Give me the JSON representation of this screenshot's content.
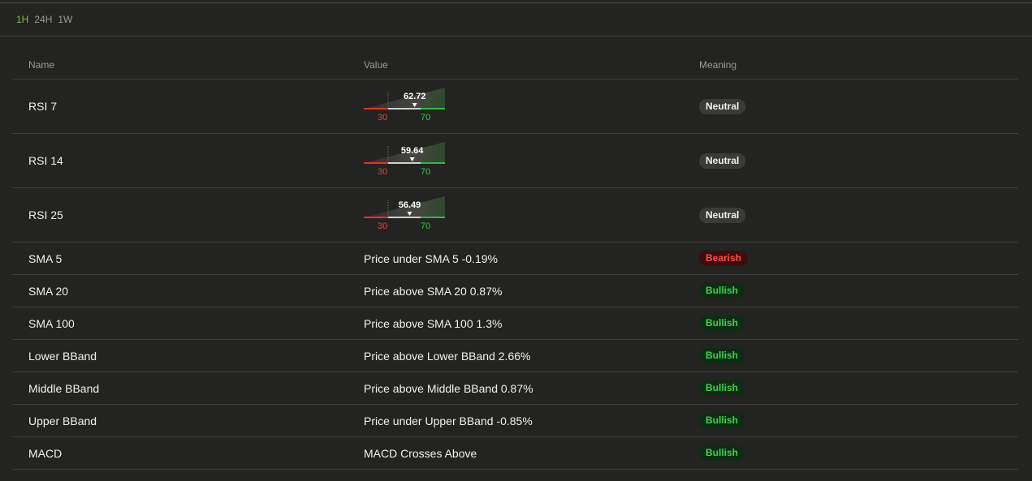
{
  "tabs": [
    {
      "label": "1H",
      "active": true
    },
    {
      "label": "24H",
      "active": false
    },
    {
      "label": "1W",
      "active": false
    }
  ],
  "columns": {
    "name": "Name",
    "value": "Value",
    "meaning": "Meaning"
  },
  "rows": [
    {
      "name": "RSI 7",
      "kind": "gauge",
      "rsi": 62.72,
      "value_label": "62.72",
      "low_label": "30",
      "high_label": "70",
      "meaning": "Neutral",
      "tone": "neutral"
    },
    {
      "name": "RSI 14",
      "kind": "gauge",
      "rsi": 59.64,
      "value_label": "59.64",
      "low_label": "30",
      "high_label": "70",
      "meaning": "Neutral",
      "tone": "neutral"
    },
    {
      "name": "RSI 25",
      "kind": "gauge",
      "rsi": 56.49,
      "value_label": "56.49",
      "low_label": "30",
      "high_label": "70",
      "meaning": "Neutral",
      "tone": "neutral"
    },
    {
      "name": "SMA 5",
      "kind": "text",
      "value": "Price under SMA 5 -0.19%",
      "meaning": "Bearish",
      "tone": "bearish"
    },
    {
      "name": "SMA 20",
      "kind": "text",
      "value": "Price above SMA 20 0.87%",
      "meaning": "Bullish",
      "tone": "bullish"
    },
    {
      "name": "SMA 100",
      "kind": "text",
      "value": "Price above SMA 100 1.3%",
      "meaning": "Bullish",
      "tone": "bullish"
    },
    {
      "name": "Lower BBand",
      "kind": "text",
      "value": "Price above Lower BBand 2.66%",
      "meaning": "Bullish",
      "tone": "bullish"
    },
    {
      "name": "Middle BBand",
      "kind": "text",
      "value": "Price above Middle BBand 0.87%",
      "meaning": "Bullish",
      "tone": "bullish"
    },
    {
      "name": "Upper BBand",
      "kind": "text",
      "value": "Price under Upper BBand -0.85%",
      "meaning": "Bullish",
      "tone": "bullish"
    },
    {
      "name": "MACD",
      "kind": "text",
      "value": "MACD Crosses Above",
      "meaning": "Bullish",
      "tone": "bullish"
    }
  ],
  "colors": {
    "background": "#232321",
    "active_tab": "#7fc241",
    "bearish": "#ff4d4d",
    "bullish": "#3ad44a",
    "oversold_zone": "#e0463c",
    "overbought_zone": "#3ac04a"
  }
}
